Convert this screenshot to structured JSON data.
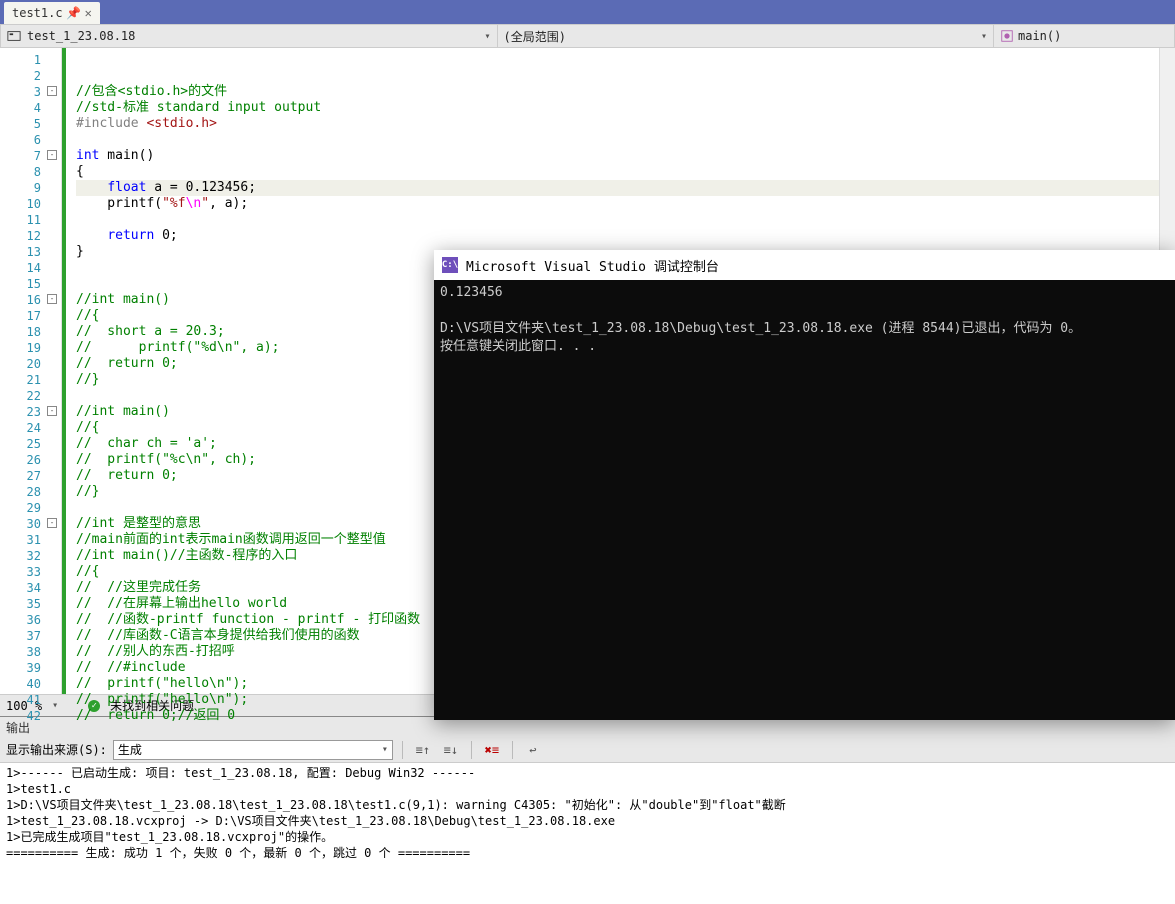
{
  "tab": {
    "name": "test1.c",
    "pin": "⊕"
  },
  "navbar": {
    "left_text": "test_1_23.08.18",
    "mid_text": "(全局范围)",
    "right_text": "main()"
  },
  "gutter": {
    "start": 1,
    "end": 42
  },
  "folds": {
    "3": "-",
    "7": "-",
    "16": "-",
    "23": "-",
    "30": "-"
  },
  "code_lines": [
    {
      "n": 1,
      "t": ""
    },
    {
      "n": 2,
      "t": ""
    },
    {
      "n": 3,
      "html": "<span class='cmt'>//包含&lt;stdio.h&gt;的文件</span>"
    },
    {
      "n": 4,
      "html": "<span class='cmt'>//std-标准 standard input output</span>"
    },
    {
      "n": 5,
      "html": "<span class='pp'>#include</span> <span class='str'>&lt;stdio.h&gt;</span>"
    },
    {
      "n": 6,
      "t": ""
    },
    {
      "n": 7,
      "html": "<span class='kw'>int</span> main()"
    },
    {
      "n": 8,
      "t": "{"
    },
    {
      "n": 9,
      "hi": true,
      "html": "    <span class='kw'>float</span> a = 0.123456;"
    },
    {
      "n": 10,
      "html": "    printf(<span class='str'>\"%f</span><span class='esc'>\\n</span><span class='str'>\"</span>, a);"
    },
    {
      "n": 11,
      "t": ""
    },
    {
      "n": 12,
      "html": "    <span class='kw'>return</span> 0;"
    },
    {
      "n": 13,
      "t": "}"
    },
    {
      "n": 14,
      "t": ""
    },
    {
      "n": 15,
      "t": ""
    },
    {
      "n": 16,
      "html": "<span class='cmt'>//int main()</span>"
    },
    {
      "n": 17,
      "html": "<span class='cmt'>//{</span>"
    },
    {
      "n": 18,
      "html": "<span class='cmt'>//  short a = 20.3;</span>"
    },
    {
      "n": 19,
      "html": "<span class='cmt'>//      printf(\"%d\\n\", a);</span>"
    },
    {
      "n": 20,
      "html": "<span class='cmt'>//  return 0;</span>"
    },
    {
      "n": 21,
      "html": "<span class='cmt'>//}</span>"
    },
    {
      "n": 22,
      "t": ""
    },
    {
      "n": 23,
      "html": "<span class='cmt'>//int main()</span>"
    },
    {
      "n": 24,
      "html": "<span class='cmt'>//{</span>"
    },
    {
      "n": 25,
      "html": "<span class='cmt'>//  char ch = 'a';</span>"
    },
    {
      "n": 26,
      "html": "<span class='cmt'>//  printf(\"%c\\n\", ch);</span>"
    },
    {
      "n": 27,
      "html": "<span class='cmt'>//  return 0;</span>"
    },
    {
      "n": 28,
      "html": "<span class='cmt'>//}</span>"
    },
    {
      "n": 29,
      "t": ""
    },
    {
      "n": 30,
      "html": "<span class='cmt'>//int 是整型的意思</span>"
    },
    {
      "n": 31,
      "html": "<span class='cmt'>//main前面的int表示main函数调用返回一个整型值</span>"
    },
    {
      "n": 32,
      "html": "<span class='cmt'>//int main()//主函数-程序的入口</span>"
    },
    {
      "n": 33,
      "html": "<span class='cmt'>//{</span>"
    },
    {
      "n": 34,
      "html": "<span class='cmt'>//  //这里完成任务</span>"
    },
    {
      "n": 35,
      "html": "<span class='cmt'>//  //在屏幕上输出hello world</span>"
    },
    {
      "n": 36,
      "html": "<span class='cmt'>//  //函数-printf function - printf - 打印函数</span>"
    },
    {
      "n": 37,
      "html": "<span class='cmt'>//  //库函数-C语言本身提供给我们使用的函数</span>"
    },
    {
      "n": 38,
      "html": "<span class='cmt'>//  //别人的东西-打招呼</span>"
    },
    {
      "n": 39,
      "html": "<span class='cmt'>//  //#include</span>"
    },
    {
      "n": 40,
      "html": "<span class='cmt'>//  printf(\"hello\\n\");</span>"
    },
    {
      "n": 41,
      "html": "<span class='cmt'>//  printf(\"hello\\n\");</span>"
    },
    {
      "n": 42,
      "html": "<span class='cmt'>//  return 0;//返回 0</span>"
    }
  ],
  "status": {
    "zoom": "100 %",
    "issues": "未找到相关问题"
  },
  "output": {
    "title": "输出",
    "src_label": "显示输出来源(S):",
    "src_value": "生成",
    "lines": [
      "1>------ 已启动生成: 项目: test_1_23.08.18, 配置: Debug Win32 ------",
      "1>test1.c",
      "1>D:\\VS项目文件夹\\test_1_23.08.18\\test_1_23.08.18\\test1.c(9,1): warning C4305: \"初始化\": 从\"double\"到\"float\"截断",
      "1>test_1_23.08.18.vcxproj -> D:\\VS项目文件夹\\test_1_23.08.18\\Debug\\test_1_23.08.18.exe",
      "1>已完成生成项目\"test_1_23.08.18.vcxproj\"的操作。",
      "========== 生成: 成功 1 个，失败 0 个，最新 0 个，跳过 0 个 =========="
    ]
  },
  "console": {
    "title": "Microsoft Visual Studio 调试控制台",
    "body": "0.123456\n\nD:\\VS项目文件夹\\test_1_23.08.18\\Debug\\test_1_23.08.18.exe (进程 8544)已退出，代码为 0。\n按任意键关闭此窗口. . ."
  }
}
